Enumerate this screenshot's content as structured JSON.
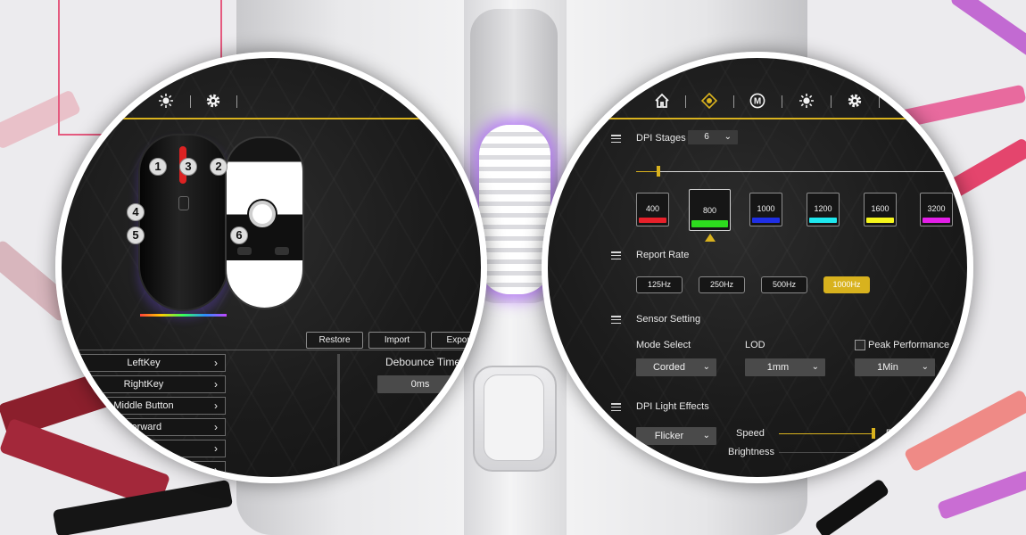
{
  "colors": {
    "accent_gold": "#d9b21e",
    "panel_bg": "#1b1b1b",
    "dpi_colors": [
      "#e8202a",
      "#2ddc1e",
      "#1f2fe6",
      "#1ee8ee",
      "#f6f61c",
      "#e41ee8"
    ]
  },
  "left_panel": {
    "toolbar_icons": [
      "brightness-icon",
      "gear-icon"
    ],
    "button_numbers": [
      "1",
      "3",
      "2",
      "4",
      "5",
      "6"
    ],
    "actions": {
      "restore": "Restore",
      "import": "Import",
      "export": "Export"
    },
    "key_list": [
      {
        "label": "LeftKey"
      },
      {
        "label": "RightKey"
      },
      {
        "label": "Middle Button"
      },
      {
        "label": "Forward"
      },
      {
        "label": "k"
      },
      {
        "label": ""
      }
    ],
    "debounce": {
      "label": "Debounce Time",
      "value": "0ms"
    }
  },
  "right_panel": {
    "toolbar_icons": [
      "home-icon",
      "dpi-crosshair-icon",
      "macro-m-icon",
      "brightness-icon",
      "gear-icon"
    ],
    "macro_letter": "M",
    "dpi_stages": {
      "label": "DPI Stages",
      "value": "6"
    },
    "dpi_slider_fraction": 0.07,
    "dpi_values": [
      "400",
      "800",
      "1000",
      "1200",
      "1600",
      "3200"
    ],
    "dpi_selected_index": 1,
    "report_rate": {
      "label": "Report Rate",
      "options": [
        "125Hz",
        "250Hz",
        "500Hz",
        "1000Hz"
      ],
      "selected_index": 3
    },
    "sensor": {
      "label": "Sensor Setting",
      "mode_label": "Mode Select",
      "mode_value": "Corded",
      "lod_label": "LOD",
      "lod_value": "1mm",
      "peak_label": "Peak Performance",
      "peak_checked": false,
      "peak_value": "1Min"
    },
    "light": {
      "label": "DPI Light Effects",
      "effect_value": "Flicker",
      "speed_label": "Speed",
      "speed_value": "5",
      "speed_fraction": 1.0,
      "brightness_label": "Brightness"
    }
  }
}
